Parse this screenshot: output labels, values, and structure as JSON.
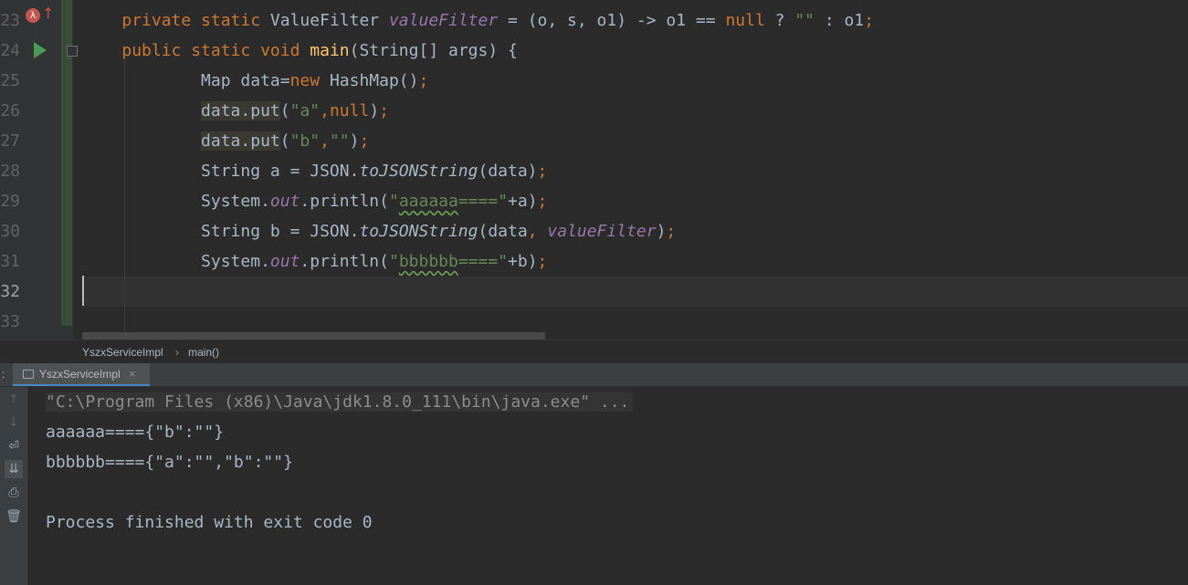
{
  "editor": {
    "line_numbers": [
      "23",
      "24",
      "25",
      "26",
      "27",
      "28",
      "29",
      "30",
      "31",
      "32",
      "33"
    ],
    "lines": [
      {
        "segments": [
          {
            "text": "    ",
            "cls": "pl"
          },
          {
            "text": "private static ",
            "cls": "kw"
          },
          {
            "text": "ValueFilter ",
            "cls": "pl"
          },
          {
            "text": "valueFilter",
            "cls": "fld"
          },
          {
            "text": " = (o, s, o1) -> o1 == ",
            "cls": "pl"
          },
          {
            "text": "null",
            "cls": "kw"
          },
          {
            "text": " ? ",
            "cls": "pl"
          },
          {
            "text": "\"\"",
            "cls": "str"
          },
          {
            "text": " : o1",
            "cls": "pl"
          },
          {
            "text": ";",
            "cls": "kw"
          }
        ]
      },
      {
        "segments": [
          {
            "text": "    ",
            "cls": "pl"
          },
          {
            "text": "public static void ",
            "cls": "kw"
          },
          {
            "text": "main",
            "cls": "fn"
          },
          {
            "text": "(String[] args) {",
            "cls": "pl"
          }
        ]
      },
      {
        "segments": [
          {
            "text": "            Map data=",
            "cls": "pl"
          },
          {
            "text": "new ",
            "cls": "kw"
          },
          {
            "text": "HashMap()",
            "cls": "pl"
          },
          {
            "text": ";",
            "cls": "kw"
          }
        ]
      },
      {
        "segments": [
          {
            "text": "            ",
            "cls": "pl"
          },
          {
            "text": "data.put",
            "cls": "pl hl"
          },
          {
            "text": "(",
            "cls": "pl"
          },
          {
            "text": "\"a\"",
            "cls": "str"
          },
          {
            "text": ",",
            "cls": "kw"
          },
          {
            "text": "null",
            "cls": "kw"
          },
          {
            "text": ")",
            "cls": "pl"
          },
          {
            "text": ";",
            "cls": "kw"
          }
        ]
      },
      {
        "segments": [
          {
            "text": "            ",
            "cls": "pl"
          },
          {
            "text": "data.put",
            "cls": "pl hl"
          },
          {
            "text": "(",
            "cls": "pl"
          },
          {
            "text": "\"b\"",
            "cls": "str"
          },
          {
            "text": ",",
            "cls": "kw"
          },
          {
            "text": "\"\"",
            "cls": "str"
          },
          {
            "text": ")",
            "cls": "pl"
          },
          {
            "text": ";",
            "cls": "kw"
          }
        ]
      },
      {
        "segments": [
          {
            "text": "            String a = JSON.",
            "cls": "pl"
          },
          {
            "text": "toJSONString",
            "cls": "stm"
          },
          {
            "text": "(data)",
            "cls": "pl"
          },
          {
            "text": ";",
            "cls": "kw"
          }
        ]
      },
      {
        "segments": [
          {
            "text": "            System.",
            "cls": "pl"
          },
          {
            "text": "out",
            "cls": "fld"
          },
          {
            "text": ".println(",
            "cls": "pl"
          },
          {
            "text": "\"",
            "cls": "str"
          },
          {
            "text": "aaaaaa",
            "cls": "str squig"
          },
          {
            "text": "====\"",
            "cls": "str"
          },
          {
            "text": "+a)",
            "cls": "pl"
          },
          {
            "text": ";",
            "cls": "kw"
          }
        ]
      },
      {
        "segments": [
          {
            "text": "            String b = JSON.",
            "cls": "pl"
          },
          {
            "text": "toJSONString",
            "cls": "stm"
          },
          {
            "text": "(data",
            "cls": "pl"
          },
          {
            "text": ", ",
            "cls": "kw"
          },
          {
            "text": "valueFilter",
            "cls": "fld"
          },
          {
            "text": ")",
            "cls": "pl"
          },
          {
            "text": ";",
            "cls": "kw"
          }
        ]
      },
      {
        "segments": [
          {
            "text": "            System.",
            "cls": "pl"
          },
          {
            "text": "out",
            "cls": "fld"
          },
          {
            "text": ".println(",
            "cls": "pl"
          },
          {
            "text": "\"",
            "cls": "str"
          },
          {
            "text": "bbbbbb",
            "cls": "str squig"
          },
          {
            "text": "====\"",
            "cls": "str"
          },
          {
            "text": "+b)",
            "cls": "pl"
          },
          {
            "text": ";",
            "cls": "kw"
          }
        ]
      },
      {
        "segments": []
      },
      {
        "segments": []
      }
    ],
    "current_line_index": 9
  },
  "breadcrumb": {
    "class_name": "YszxServiceImpl",
    "separator": "›",
    "method_name": "main()"
  },
  "run_panel": {
    "tab_prefix": ":",
    "tab_label": "YszxServiceImpl",
    "close_glyph": "×",
    "toolbar_icons": [
      "arrow-up-icon",
      "arrow-down-icon",
      "soft-wrap-icon",
      "scroll-to-end-icon",
      "print-icon",
      "trash-icon"
    ]
  },
  "console": {
    "command": "\"C:\\Program Files (x86)\\Java\\jdk1.8.0_111\\bin\\java.exe\" ...",
    "output_1": "aaaaaa===={\"b\":\"\"}",
    "output_2": "bbbbbb===={\"a\":\"\",\"b\":\"\"}",
    "finish": "Process finished with exit code 0"
  },
  "colors": {
    "background": "#2b2b2b",
    "keyword": "#cc7832",
    "string": "#6a8759",
    "field": "#9876aa",
    "method": "#ffc66d",
    "text": "#a9b7c6"
  }
}
